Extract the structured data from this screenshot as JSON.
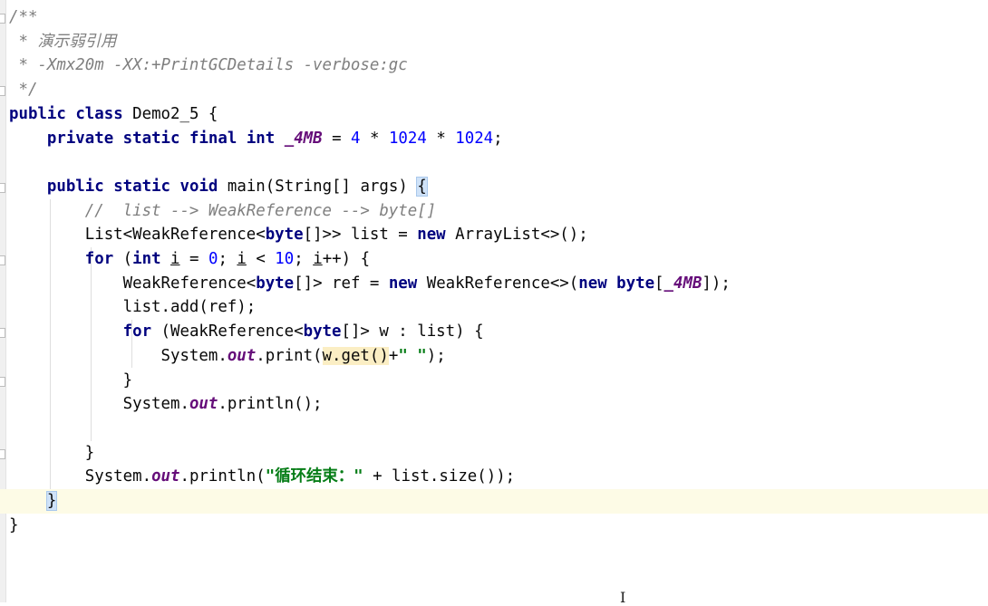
{
  "editor": {
    "lines": [
      [
        {
          "t": "/**",
          "c": "com"
        }
      ],
      [
        {
          "t": " * 演示弱引用",
          "c": "com"
        }
      ],
      [
        {
          "t": " * -Xmx20m -XX:+PrintGCDetails -verbose:gc",
          "c": "com"
        }
      ],
      [
        {
          "t": " */",
          "c": "com"
        }
      ],
      [
        {
          "t": "public",
          "c": "kw"
        },
        {
          "t": " "
        },
        {
          "t": "class",
          "c": "kw"
        },
        {
          "t": " Demo2_5 {"
        }
      ],
      [
        {
          "t": "    "
        },
        {
          "t": "private",
          "c": "kw"
        },
        {
          "t": " "
        },
        {
          "t": "static",
          "c": "kw"
        },
        {
          "t": " "
        },
        {
          "t": "final",
          "c": "kw"
        },
        {
          "t": " "
        },
        {
          "t": "int",
          "c": "kw"
        },
        {
          "t": " "
        },
        {
          "t": "_4MB",
          "c": "cst"
        },
        {
          "t": " = "
        },
        {
          "t": "4",
          "c": "num"
        },
        {
          "t": " * "
        },
        {
          "t": "1024",
          "c": "num"
        },
        {
          "t": " * "
        },
        {
          "t": "1024",
          "c": "num"
        },
        {
          "t": ";"
        }
      ],
      [],
      [
        {
          "t": "    "
        },
        {
          "t": "public",
          "c": "kw"
        },
        {
          "t": " "
        },
        {
          "t": "static",
          "c": "kw"
        },
        {
          "t": " "
        },
        {
          "t": "void",
          "c": "kw"
        },
        {
          "t": " main(String[] args) "
        },
        {
          "t": "{",
          "c": "brace-hl"
        }
      ],
      [
        {
          "t": "        "
        },
        {
          "t": "//  list --> WeakReference --> byte[]",
          "c": "com"
        }
      ],
      [
        {
          "t": "        List<WeakReference<"
        },
        {
          "t": "byte",
          "c": "kw"
        },
        {
          "t": "[]>> list = "
        },
        {
          "t": "new",
          "c": "kw"
        },
        {
          "t": " ArrayList<>();"
        }
      ],
      [
        {
          "t": "        "
        },
        {
          "t": "for",
          "c": "kw"
        },
        {
          "t": " ("
        },
        {
          "t": "int",
          "c": "kw"
        },
        {
          "t": " "
        },
        {
          "t": "i",
          "c": "ul"
        },
        {
          "t": " = "
        },
        {
          "t": "0",
          "c": "num"
        },
        {
          "t": "; "
        },
        {
          "t": "i",
          "c": "ul"
        },
        {
          "t": " < "
        },
        {
          "t": "10",
          "c": "num"
        },
        {
          "t": "; "
        },
        {
          "t": "i",
          "c": "ul"
        },
        {
          "t": "++) {"
        }
      ],
      [
        {
          "t": "            WeakReference<"
        },
        {
          "t": "byte",
          "c": "kw"
        },
        {
          "t": "[]> ref = "
        },
        {
          "t": "new",
          "c": "kw"
        },
        {
          "t": " WeakReference<>("
        },
        {
          "t": "new",
          "c": "kw"
        },
        {
          "t": " "
        },
        {
          "t": "byte",
          "c": "kw"
        },
        {
          "t": "["
        },
        {
          "t": "_4MB",
          "c": "cst"
        },
        {
          "t": "]);"
        }
      ],
      [
        {
          "t": "            list.add(ref);"
        }
      ],
      [
        {
          "t": "            "
        },
        {
          "t": "for",
          "c": "kw"
        },
        {
          "t": " (WeakReference<"
        },
        {
          "t": "byte",
          "c": "kw"
        },
        {
          "t": "[]> w : list) {"
        }
      ],
      [
        {
          "t": "                System."
        },
        {
          "t": "out",
          "c": "fld"
        },
        {
          "t": ".print("
        },
        {
          "t": "w.get()",
          "c": "hl"
        },
        {
          "t": "+"
        },
        {
          "t": "\" \"",
          "c": "str"
        },
        {
          "t": ");"
        }
      ],
      [
        {
          "t": "            }"
        }
      ],
      [
        {
          "t": "            System."
        },
        {
          "t": "out",
          "c": "fld"
        },
        {
          "t": ".println();"
        }
      ],
      [],
      [
        {
          "t": "        }"
        }
      ],
      [
        {
          "t": "        System."
        },
        {
          "t": "out",
          "c": "fld"
        },
        {
          "t": ".println("
        },
        {
          "t": "\"循环结束：\"",
          "c": "str"
        },
        {
          "t": " + list.size());"
        }
      ],
      [
        {
          "t": "    "
        },
        {
          "t": "}",
          "c": "brace-hl"
        }
      ],
      [
        {
          "t": "}"
        }
      ]
    ],
    "current_line": 20
  }
}
